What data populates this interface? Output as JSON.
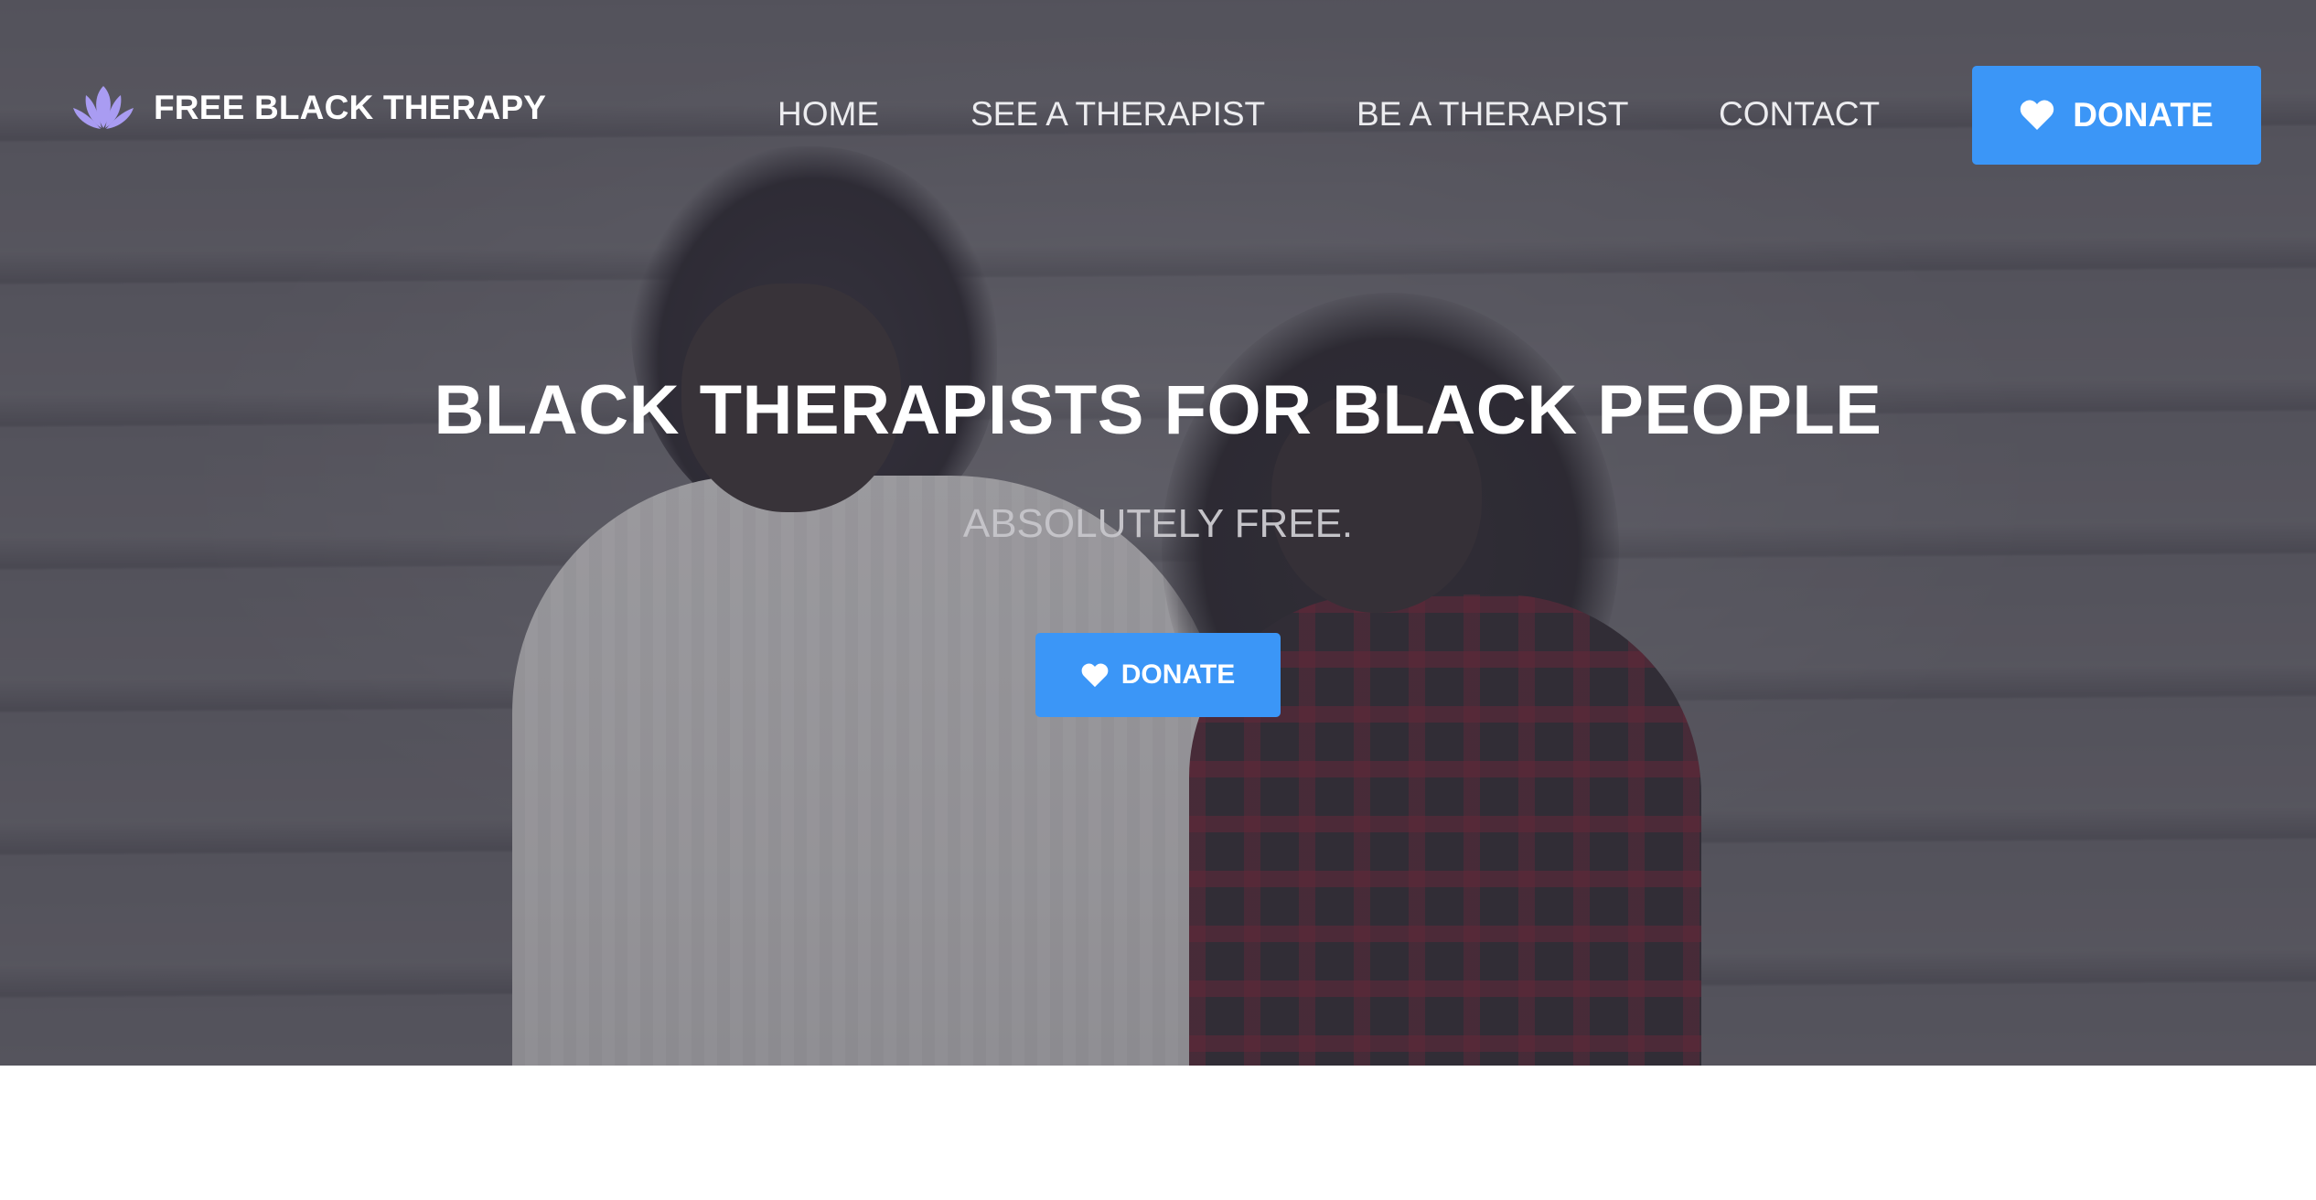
{
  "brand": {
    "name": "FREE BLACK THERAPY",
    "icon": "lotus-icon",
    "icon_color": "#a99cf2"
  },
  "nav": {
    "items": [
      {
        "label": "HOME"
      },
      {
        "label": "SEE A THERAPIST"
      },
      {
        "label": "BE A THERAPIST"
      },
      {
        "label": "CONTACT"
      }
    ],
    "donate_label": "DONATE",
    "donate_icon": "heart-icon"
  },
  "hero": {
    "headline": "BLACK THERAPISTS FOR BLACK PEOPLE",
    "subhead": "ABSOLUTELY FREE.",
    "donate_label": "DONATE",
    "donate_icon": "heart-icon"
  },
  "colors": {
    "accent": "#3b96f7",
    "text_light": "#ffffff"
  }
}
